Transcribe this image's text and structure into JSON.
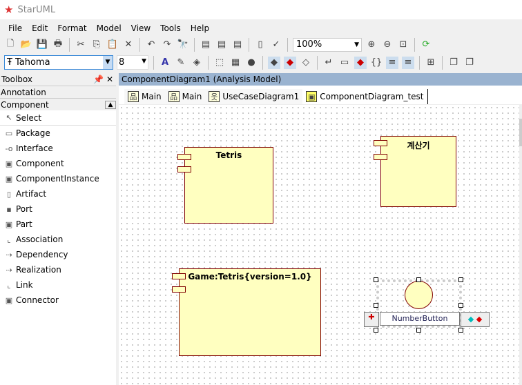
{
  "app": {
    "title": "StarUML"
  },
  "menu": [
    "File",
    "Edit",
    "Format",
    "Model",
    "View",
    "Tools",
    "Help"
  ],
  "toolbar": {
    "font": "Tahoma",
    "size": "8",
    "zoom": "100%"
  },
  "toolbox": {
    "title": "Toolbox",
    "categories": [
      "Annotation",
      "Component"
    ],
    "items": [
      "Select",
      "Package",
      "Interface",
      "Component",
      "ComponentInstance",
      "Artifact",
      "Port",
      "Part",
      "Association",
      "Dependency",
      "Realization",
      "Link",
      "Connector"
    ],
    "icons": [
      "↖",
      "▭",
      "-o",
      "▣",
      "▣",
      "▯",
      "▪",
      "▣",
      "⌞",
      "⇢",
      "⇢",
      "⌞",
      "▣"
    ]
  },
  "diagram": {
    "header": "ComponentDiagram1 (Analysis Model)",
    "tabs": [
      "Main",
      "Main",
      "UseCaseDiagram1",
      "ComponentDiagram_test"
    ],
    "elements": {
      "c1": "Tetris",
      "c2": "계산기",
      "c3": "Game:Tetris{version=1.0}",
      "iface": "NumberButton"
    }
  },
  "colors": {
    "component_fill": "#ffffc0",
    "component_border": "#800000",
    "header": "#9ab3d0"
  }
}
